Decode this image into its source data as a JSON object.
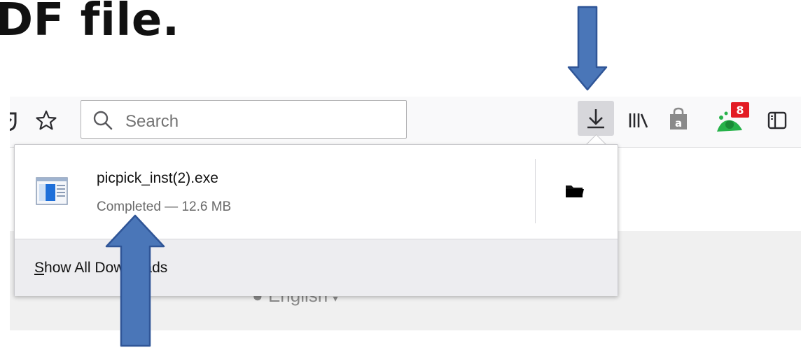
{
  "slide": {
    "title": "DF file."
  },
  "toolbar": {
    "search_placeholder": "Search",
    "extension_badge": "8"
  },
  "downloads_panel": {
    "item": {
      "filename": "picpick_inst(2).exe",
      "status": "Completed — 12.6 MB"
    },
    "footer": {
      "accesskey": "S",
      "rest": "how All Downloads"
    }
  },
  "page": {
    "language_label": "English"
  },
  "colors": {
    "arrow_fill": "#4a76b8",
    "arrow_stroke": "#2f5597",
    "badge": "#e31b23",
    "file_icon_blue": "#1e6fd9"
  }
}
